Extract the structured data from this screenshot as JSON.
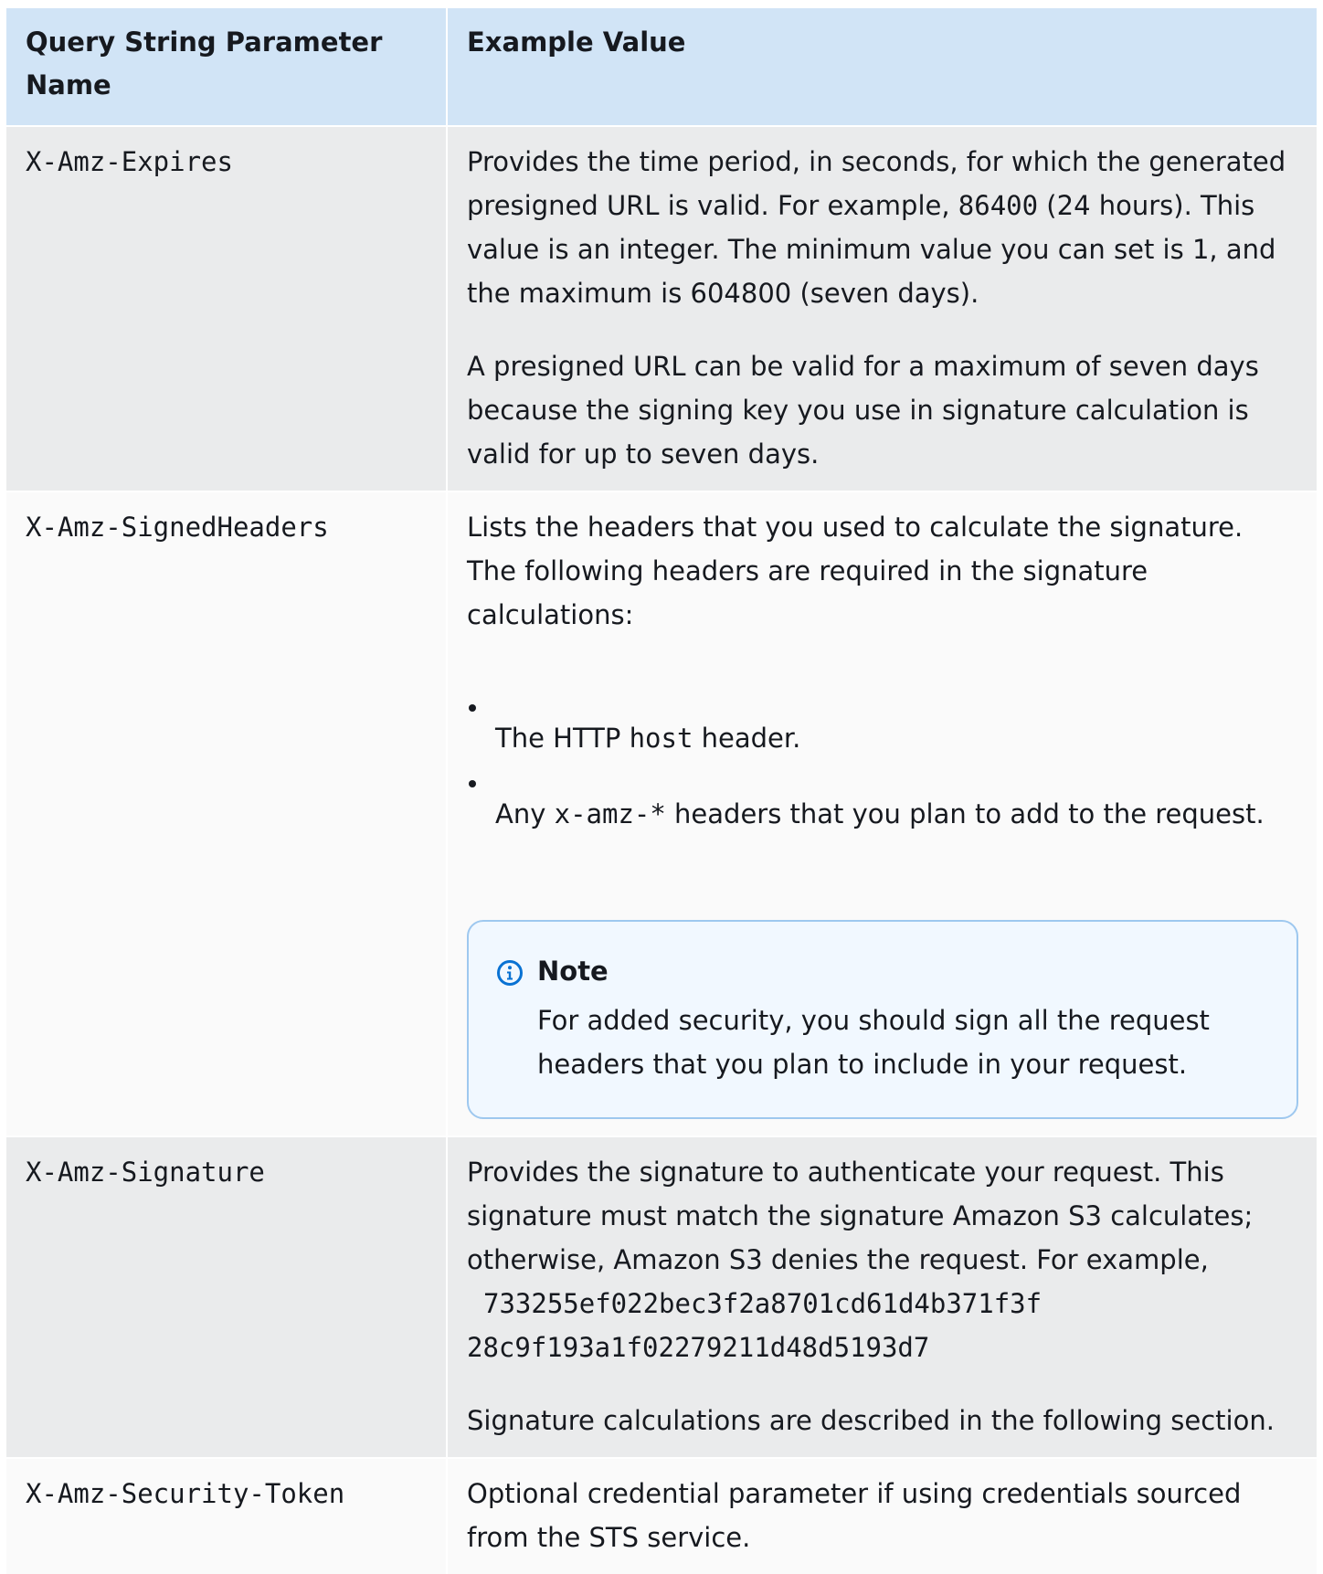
{
  "table": {
    "headers": {
      "name": "Query String Parameter Name",
      "value": "Example Value"
    },
    "rows": [
      {
        "name": "X-Amz-Expires",
        "p1_a": "Provides the time period, in seconds, for which the generated presigned URL is valid. For example, ",
        "p1_code": "86400",
        "p1_b": " (24 hours).  This value is an integer. The minimum value you can set is 1, and the maximum is 604800 (seven days).",
        "p2": "A presigned URL can be valid for a maximum of seven days because  the signing key you use in signature calculation is valid for up to  seven days."
      },
      {
        "name": "X-Amz-SignedHeaders",
        "intro": "Lists the headers that you used to calculate the signature. The following headers are  required in the signature calculations:",
        "bullets": [
          {
            "pre": "The HTTP ",
            "code": "host",
            "post": " header."
          },
          {
            "pre": "Any ",
            "code": "x-amz-*",
            "post": " headers that you plan to add  to the request."
          }
        ],
        "note": {
          "title": "Note",
          "text": "For added security, you should sign all the request headers that you plan to include in your request."
        }
      },
      {
        "name": "X-Amz-Signature",
        "p1": "Provides the signature to authenticate your request. This signature must match the signature Amazon S3 calculates; otherwise, Amazon S3  denies the request. For example,",
        "code_line1": "733255ef022bec3f2a8701cd61d4b371f3f",
        "code_line2": "28c9f193a1f02279211d48d5193d7",
        "p2": "Signature calculations are described in the following section."
      },
      {
        "name": "X-Amz-Security-Token",
        "p1": "Optional credential parameter if using credentials sourced from the STS service."
      }
    ]
  },
  "icons": {
    "note": "info-circle-icon"
  },
  "colors": {
    "header_bg": "#d1e4f6",
    "row_odd_bg": "#eaebec",
    "row_even_bg": "#fafafa",
    "note_border": "#9ec8ef",
    "note_bg": "#f1f8ff",
    "info_icon": "#0972d3"
  }
}
